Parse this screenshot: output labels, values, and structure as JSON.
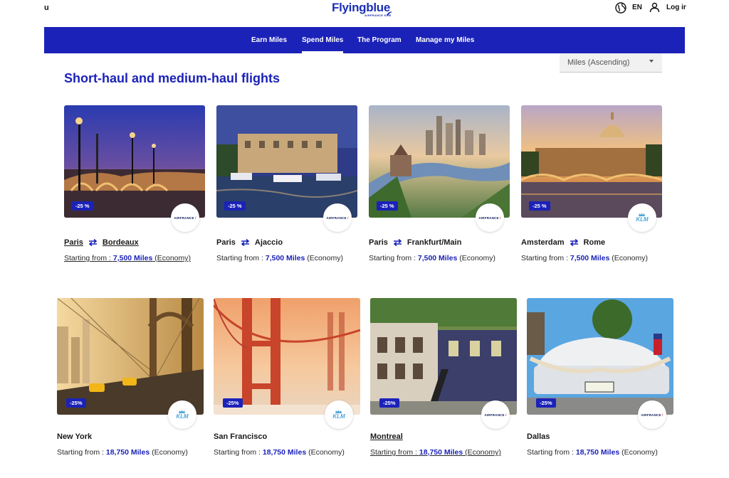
{
  "header": {
    "left_fragment": "u",
    "logo_text": "Flyingblue",
    "logo_sub": "AIRFRANCE KLM",
    "language": "EN",
    "login_label": "Log ir"
  },
  "nav": {
    "items": [
      {
        "label": "Earn Miles"
      },
      {
        "label": "Spend Miles"
      },
      {
        "label": "The Program"
      },
      {
        "label": "Manage my Miles"
      }
    ]
  },
  "sort": {
    "selected": "Miles (Ascending)"
  },
  "section": {
    "title": "Short-haul and medium-haul flights"
  },
  "cards": [
    {
      "from": "Paris",
      "to": "Bordeaux",
      "discount": "-25 %",
      "airline": "AIRFRANCE",
      "price_prefix": "Starting from : ",
      "miles": "7,500 Miles",
      "cabin": " (Economy)"
    },
    {
      "from": "Paris",
      "to": "Ajaccio",
      "discount": "-25 %",
      "airline": "AIRFRANCE",
      "price_prefix": "Starting from : ",
      "miles": "7,500 Miles",
      "cabin": " (Economy)"
    },
    {
      "from": "Paris",
      "to": "Frankfurt/Main",
      "discount": "-25 %",
      "airline": "AIRFRANCE",
      "price_prefix": "Starting from : ",
      "miles": "7,500 Miles",
      "cabin": " (Economy)"
    },
    {
      "from": "Amsterdam",
      "to": "Rome",
      "discount": "-25 %",
      "airline": "KLM",
      "price_prefix": "Starting from : ",
      "miles": "7,500 Miles",
      "cabin": " (Economy)"
    },
    {
      "city": "New York",
      "discount": "-25%",
      "airline": "KLM",
      "price_prefix": "Starting from : ",
      "miles": "18,750 Miles",
      "cabin": " (Economy)"
    },
    {
      "city": "San Francisco",
      "discount": "-25%",
      "airline": "KLM",
      "price_prefix": "Starting from : ",
      "miles": "18,750 Miles",
      "cabin": " (Economy)"
    },
    {
      "city": "Montreal",
      "discount": "-25%",
      "airline": "AIRFRANCE",
      "price_prefix": "Starting from : ",
      "miles": "18,750 Miles",
      "cabin": " (Economy)"
    },
    {
      "city": "Dallas",
      "discount": "-25%",
      "airline": "AIRFRANCE",
      "price_prefix": "Starting from : ",
      "miles": "18,750 Miles",
      "cabin": " (Economy)"
    }
  ],
  "colors": {
    "brand": "#1b22b8",
    "klm": "#4fa6d8",
    "af_red": "#d8232a"
  },
  "icons": {
    "globe": "globe-icon",
    "user": "user-icon",
    "swap": "swap-arrows-icon",
    "caret": "chevron-down-icon"
  }
}
